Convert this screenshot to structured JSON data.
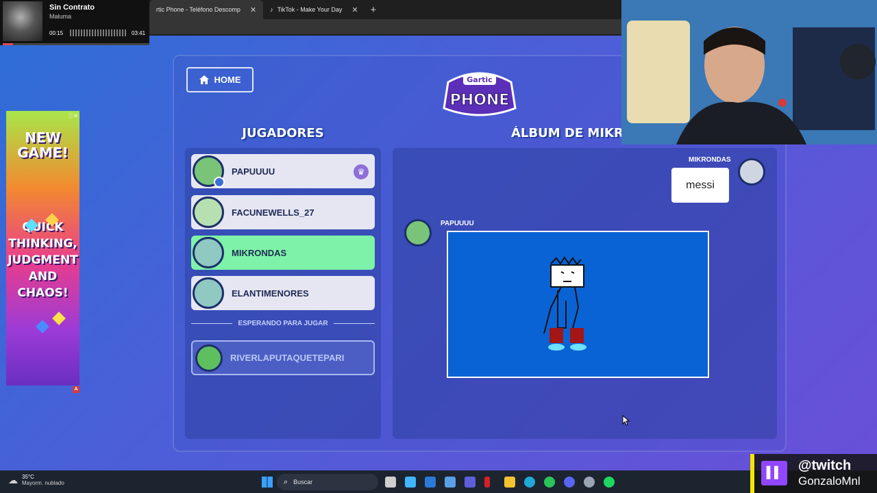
{
  "music": {
    "song": "Sin Contrato",
    "artist": "Maluma",
    "elapsed": "00:15",
    "duration": "03:41",
    "progress_fraction": 0.07
  },
  "browser": {
    "tabs": [
      {
        "label": "rtic Phone - Teléfono Descomp",
        "close": "✕",
        "active": true
      },
      {
        "label": "TikTok - Make Your Day",
        "close": "✕",
        "active": false
      }
    ],
    "new_tab": "+"
  },
  "ad": {
    "title": "NEW\nGAME!",
    "body": "QUICK\nTHINKING,\nJUDGMENT\nAND\nCHAOS!",
    "badge": "A"
  },
  "game": {
    "home_label": "HOME",
    "logo_top": "Gartic",
    "logo_bottom": "PHONE",
    "players_heading": "JUGADORES",
    "album_heading": "ÁLBUM DE MIKRO",
    "players": [
      {
        "name": "PAPUUUU",
        "host": true,
        "active": false
      },
      {
        "name": "FACUNEWELLS_27",
        "host": false,
        "active": false
      },
      {
        "name": "MIKRONDAS",
        "host": false,
        "active": true
      },
      {
        "name": "ELANTIMENORES",
        "host": false,
        "active": false
      }
    ],
    "waiting_label": "ESPERANDO PARA JUGAR",
    "waiting_player": "RIVERLAPUTAQUETEPARI",
    "album": {
      "message_author": "MIKRONDAS",
      "message_text": "messi",
      "drawing_author": "PAPUUUU"
    }
  },
  "taskbar": {
    "temperature": "35°C",
    "condition": "Mayorm. nublado",
    "search_placeholder": "Buscar"
  },
  "twitch": {
    "handle": "@twitch",
    "user": "GonzaloMnl"
  },
  "colors": {
    "active_player": "#7ef2a8",
    "canvas": "#0a63d4",
    "twitch_purple": "#9146ff"
  }
}
